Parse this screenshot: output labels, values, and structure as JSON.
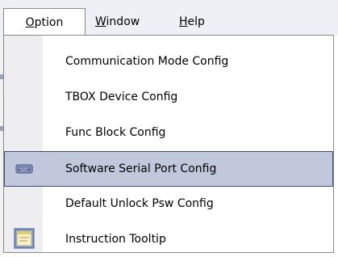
{
  "menubar": {
    "items": [
      {
        "label_acc": "O",
        "label_rest": "ption"
      },
      {
        "label_acc": "W",
        "label_rest": "indow"
      },
      {
        "label_acc": "H",
        "label_rest": "elp"
      }
    ]
  },
  "dropdown": {
    "items": [
      {
        "label": "Communication Mode Config",
        "icon": null,
        "highlighted": false
      },
      {
        "label": "TBOX Device Config",
        "icon": null,
        "highlighted": false
      },
      {
        "label": "Func Block Config",
        "icon": null,
        "highlighted": false
      },
      {
        "label": "Software Serial Port Config",
        "icon": "serial-port-icon",
        "highlighted": true
      },
      {
        "label": "Default Unlock Psw Config",
        "icon": null,
        "highlighted": false
      },
      {
        "label": "Instruction Tooltip",
        "icon": "tooltip-window-icon",
        "highlighted": false
      }
    ]
  },
  "colors": {
    "highlight_fill": "#c1c8dc",
    "highlight_border": "#3b4d7d",
    "gutter": "#eeeef0"
  }
}
